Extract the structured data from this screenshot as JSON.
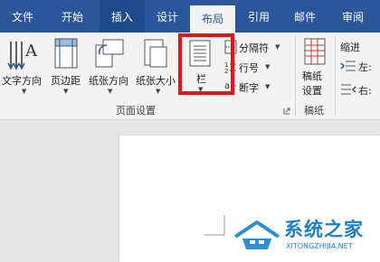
{
  "tabs": [
    "文件",
    "开始",
    "插入",
    "设计",
    "布局",
    "引用",
    "邮件",
    "审阅"
  ],
  "ribbon": {
    "text_direction": "文字方向",
    "margins": "页边距",
    "orientation": "纸张方向",
    "size": "纸张大小",
    "columns": "栏",
    "breaks": "分隔符",
    "line_numbers": "行号",
    "hyphenation": "断字",
    "manuscript_settings": "稿纸\n设置",
    "indent": "缩进",
    "left": "左:",
    "right": "右:",
    "group_page_setup": "页面设置",
    "group_manuscript": "稿纸"
  },
  "watermark": {
    "title": "系统之家",
    "subtitle": "XITONGZHIJIA.NET"
  },
  "colors": {
    "accent": "#2b579a",
    "highlight": "#e0141c"
  }
}
